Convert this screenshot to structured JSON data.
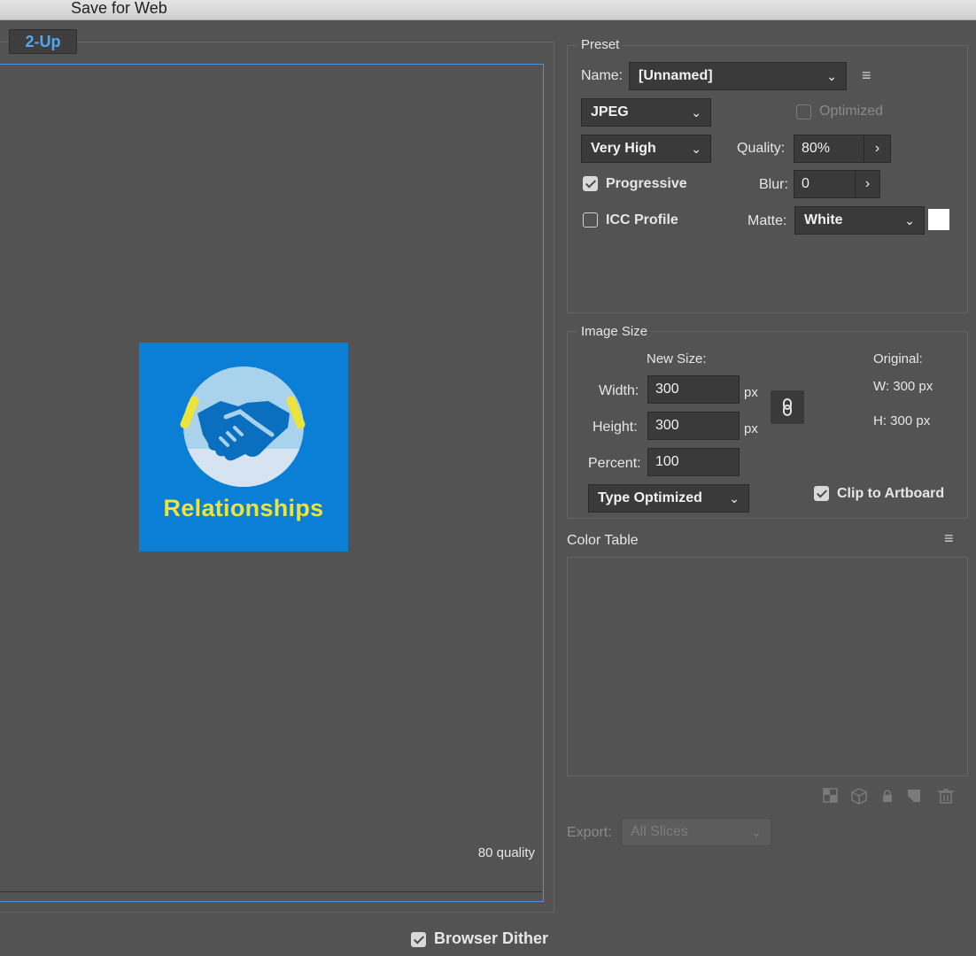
{
  "window": {
    "title": "Save for Web"
  },
  "preview": {
    "tab_label": "2-Up",
    "quality_caption": "80 quality",
    "artwork_text": "Relationships",
    "browser_dither_label": "Browser Dither",
    "browser_dither_checked": true
  },
  "preset": {
    "section_title": "Preset",
    "name_label": "Name:",
    "name_value": "[Unnamed]",
    "format_value": "JPEG",
    "optimized_label": "Optimized",
    "compression_value": "Very High",
    "quality_label": "Quality:",
    "quality_value": "80%",
    "progressive_label": "Progressive",
    "blur_label": "Blur:",
    "blur_value": "0",
    "icc_label": "ICC Profile",
    "matte_label": "Matte:",
    "matte_value": "White",
    "matte_swatch_color": "#ffffff"
  },
  "image_size": {
    "section_title": "Image Size",
    "new_size_label": "New Size:",
    "original_label": "Original:",
    "width_label": "Width:",
    "width_value": "300",
    "height_label": "Height:",
    "height_value": "300",
    "percent_label": "Percent:",
    "percent_value": "100",
    "unit_px": "px",
    "original_w": "W:  300 px",
    "original_h": "H:  300 px",
    "resample_value": "Type Optimized",
    "clip_label": "Clip to Artboard",
    "clip_checked": true
  },
  "color_table": {
    "section_title": "Color Table",
    "export_label": "Export:",
    "export_value": "All Slices"
  },
  "colors": {
    "accent": "#4a90e2",
    "artwork_bg": "#0b7fd6",
    "artwork_text": "#ece43a"
  }
}
